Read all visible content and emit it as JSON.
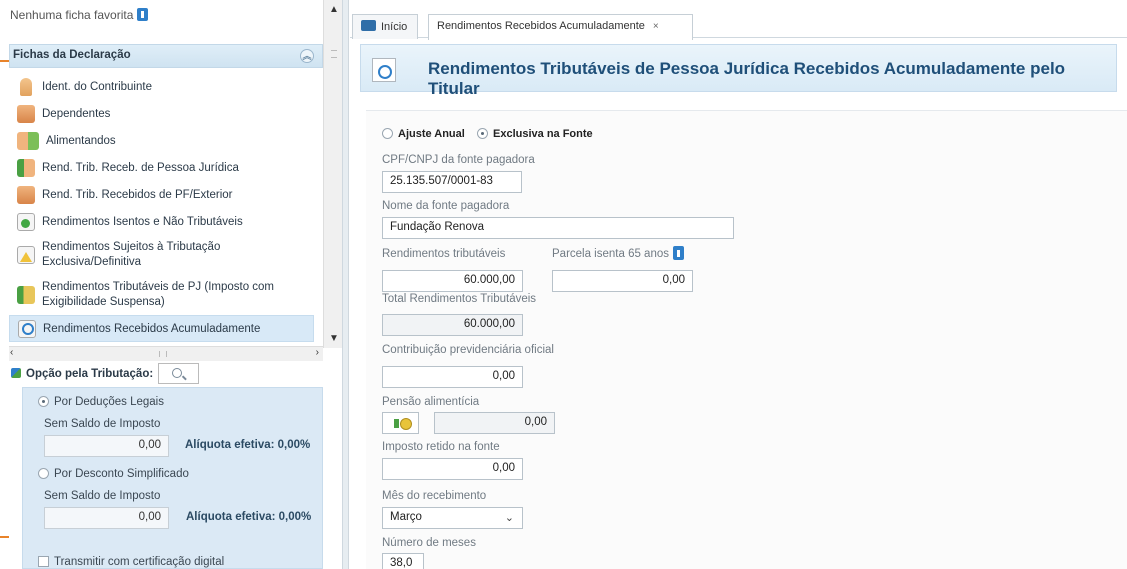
{
  "sidebar": {
    "favorites_text": "Nenhuma ficha favorita",
    "fichas_header": "Fichas da Declaração",
    "fichas": [
      {
        "label": "Ident. do Contribuinte",
        "icon": "person-icon"
      },
      {
        "label": "Dependentes",
        "icon": "dependents-icon"
      },
      {
        "label": "Alimentandos",
        "icon": "alimentandos-icon"
      },
      {
        "label": "Rend. Trib. Receb. de Pessoa Jurídica",
        "icon": "income-pj-icon"
      },
      {
        "label": "Rend. Trib. Recebidos de PF/Exterior",
        "icon": "income-pf-icon"
      },
      {
        "label": "Rendimentos Isentos e Não Tributáveis",
        "icon": "exempt-income-icon"
      },
      {
        "label": "Rendimentos Sujeitos à Tributação Exclusiva/Definitiva",
        "icon": "warning-doc-icon"
      },
      {
        "label": "Rendimentos Tributáveis de PJ (Imposto com Exigibilidade Suspensa)",
        "icon": "suspended-income-icon"
      },
      {
        "label": "Rendimentos Recebidos Acumuladamente",
        "icon": "accumulated-income-icon"
      }
    ],
    "opcao_label": "Opção pela Tributação:",
    "deducoes_legais_label": "Por Deduções Legais",
    "deducoes_saldo_label": "Sem Saldo de Imposto",
    "deducoes_value": "0,00",
    "deducoes_aliquota": "Alíquota efetiva: 0,00%",
    "simplificado_label": "Por Desconto Simplificado",
    "simplificado_saldo_label": "Sem Saldo de Imposto",
    "simplificado_value": "0,00",
    "simplificado_aliquota": "Alíquota efetiva: 0,00%",
    "transmitir_label": "Transmitir com certificação digital"
  },
  "tabs": {
    "home": "Início",
    "active": "Rendimentos Recebidos Acumuladamente",
    "close": "×"
  },
  "page": {
    "title": "Rendimentos Tributáveis de Pessoa Jurídica Recebidos Acumuladamente pelo Titular"
  },
  "form": {
    "radio_ajuste": "Ajuste Anual",
    "radio_exclusiva": "Exclusiva na Fonte",
    "selected_radio": "Exclusiva na Fonte",
    "cpf_label": "CPF/CNPJ da fonte pagadora",
    "cpf_value": "25.135.507/0001-83",
    "nome_label": "Nome da fonte pagadora",
    "nome_value": "Fundação Renova",
    "rend_trib_label": "Rendimentos tributáveis",
    "rend_trib_value": "60.000,00",
    "parcela_label": "Parcela isenta 65 anos",
    "parcela_value": "0,00",
    "total_label": "Total Rendimentos Tributáveis",
    "total_value": "60.000,00",
    "contrib_label": "Contribuição previdenciária oficial",
    "contrib_value": "0,00",
    "pensao_label": "Pensão alimentícia",
    "pensao_value": "0,00",
    "imposto_label": "Imposto retido na fonte",
    "imposto_value": "0,00",
    "mes_label": "Mês do recebimento",
    "mes_value": "Março",
    "meses_label": "Número de meses",
    "meses_value": "38,0"
  }
}
